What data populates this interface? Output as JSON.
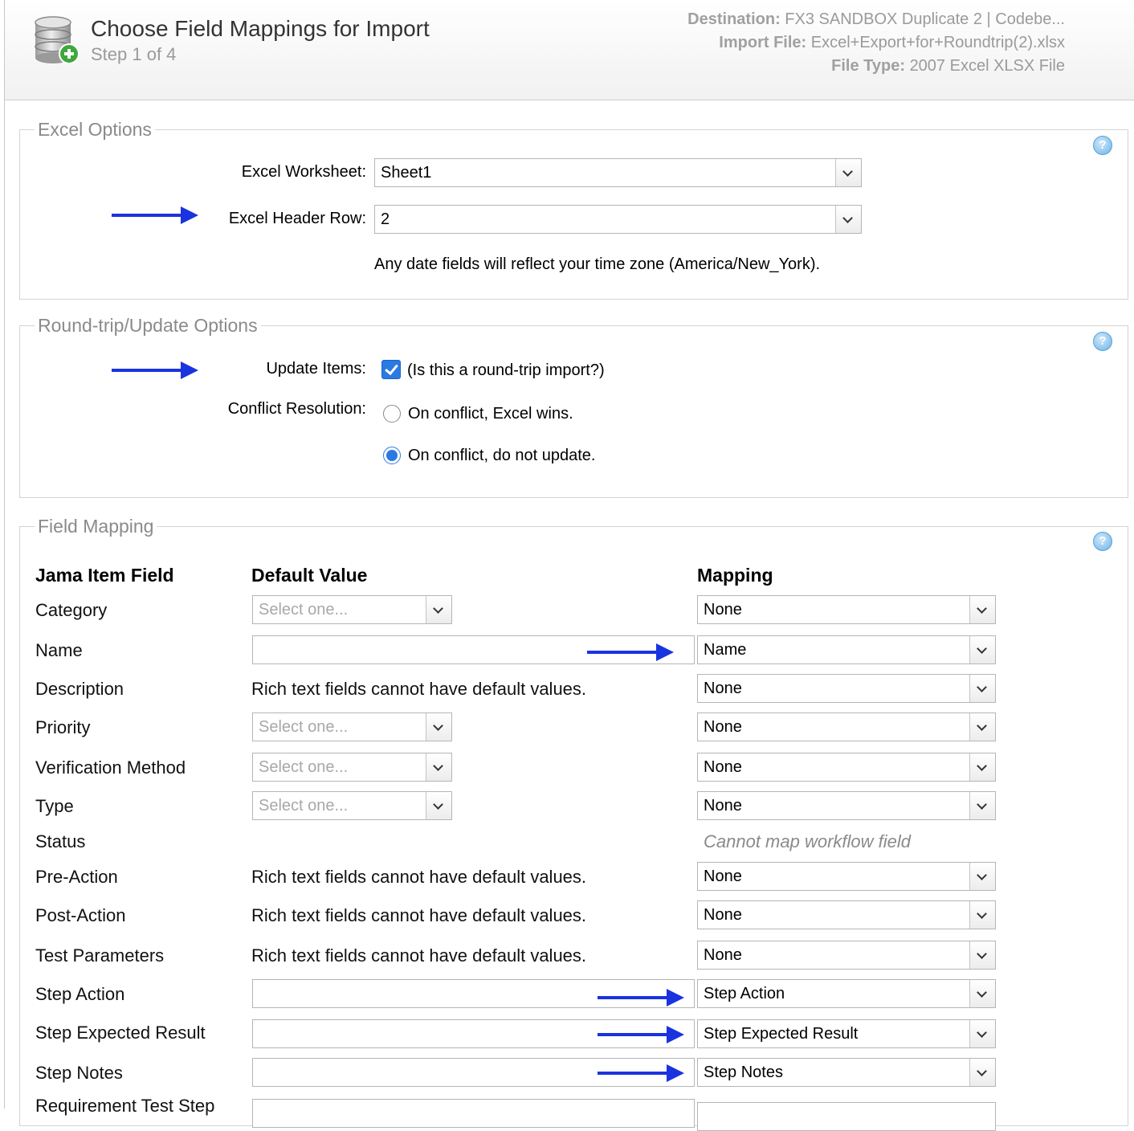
{
  "header": {
    "title": "Choose Field Mappings for Import",
    "step": "Step 1 of 4",
    "destination_label": "Destination:",
    "destination_value": "FX3 SANDBOX Duplicate 2 | Codebe...",
    "import_file_label": "Import File:",
    "import_file_value": "Excel+Export+for+Roundtrip(2).xlsx",
    "file_type_label": "File Type:",
    "file_type_value": "2007 Excel XLSX File"
  },
  "excel_options": {
    "legend": "Excel Options",
    "worksheet_label": "Excel Worksheet:",
    "worksheet_value": "Sheet1",
    "header_row_label": "Excel Header Row:",
    "header_row_value": "2",
    "timezone_note": "Any date fields will reflect your time zone (America/New_York)."
  },
  "roundtrip_options": {
    "legend": "Round-trip/Update Options",
    "update_items_label": "Update Items:",
    "update_items_note": "(Is this a round-trip import?)",
    "update_items_checked": true,
    "conflict_label": "Conflict Resolution:",
    "conflict_option_1": "On conflict, Excel wins.",
    "conflict_option_2": "On conflict, do not update.",
    "conflict_selected": 2
  },
  "field_mapping": {
    "legend": "Field Mapping",
    "col_field": "Jama Item Field",
    "col_default": "Default Value",
    "col_mapping": "Mapping",
    "select_placeholder": "Select one...",
    "rich_text_note": "Rich text fields cannot have default values.",
    "workflow_note": "Cannot map workflow field",
    "rows": {
      "category": {
        "field": "Category",
        "mapping": "None"
      },
      "name": {
        "field": "Name",
        "mapping": "Name"
      },
      "description": {
        "field": "Description",
        "mapping": "None"
      },
      "priority": {
        "field": "Priority",
        "mapping": "None"
      },
      "verification_method": {
        "field": "Verification Method",
        "mapping": "None"
      },
      "type": {
        "field": "Type",
        "mapping": "None"
      },
      "status": {
        "field": "Status"
      },
      "pre_action": {
        "field": "Pre-Action",
        "mapping": "None"
      },
      "post_action": {
        "field": "Post-Action",
        "mapping": "None"
      },
      "test_parameters": {
        "field": "Test Parameters",
        "mapping": "None"
      },
      "step_action": {
        "field": "Step Action",
        "mapping": "Step Action"
      },
      "step_expected_result": {
        "field": "Step Expected Result",
        "mapping": "Step Expected Result"
      },
      "step_notes": {
        "field": "Step Notes",
        "mapping": "Step Notes"
      },
      "requirement_test_step": {
        "field": "Requirement Test Step"
      }
    }
  },
  "icons": {
    "help": "?"
  },
  "colors": {
    "annotation_arrow": "#1a33e0",
    "checkbox_accent": "#2a7ae2"
  }
}
